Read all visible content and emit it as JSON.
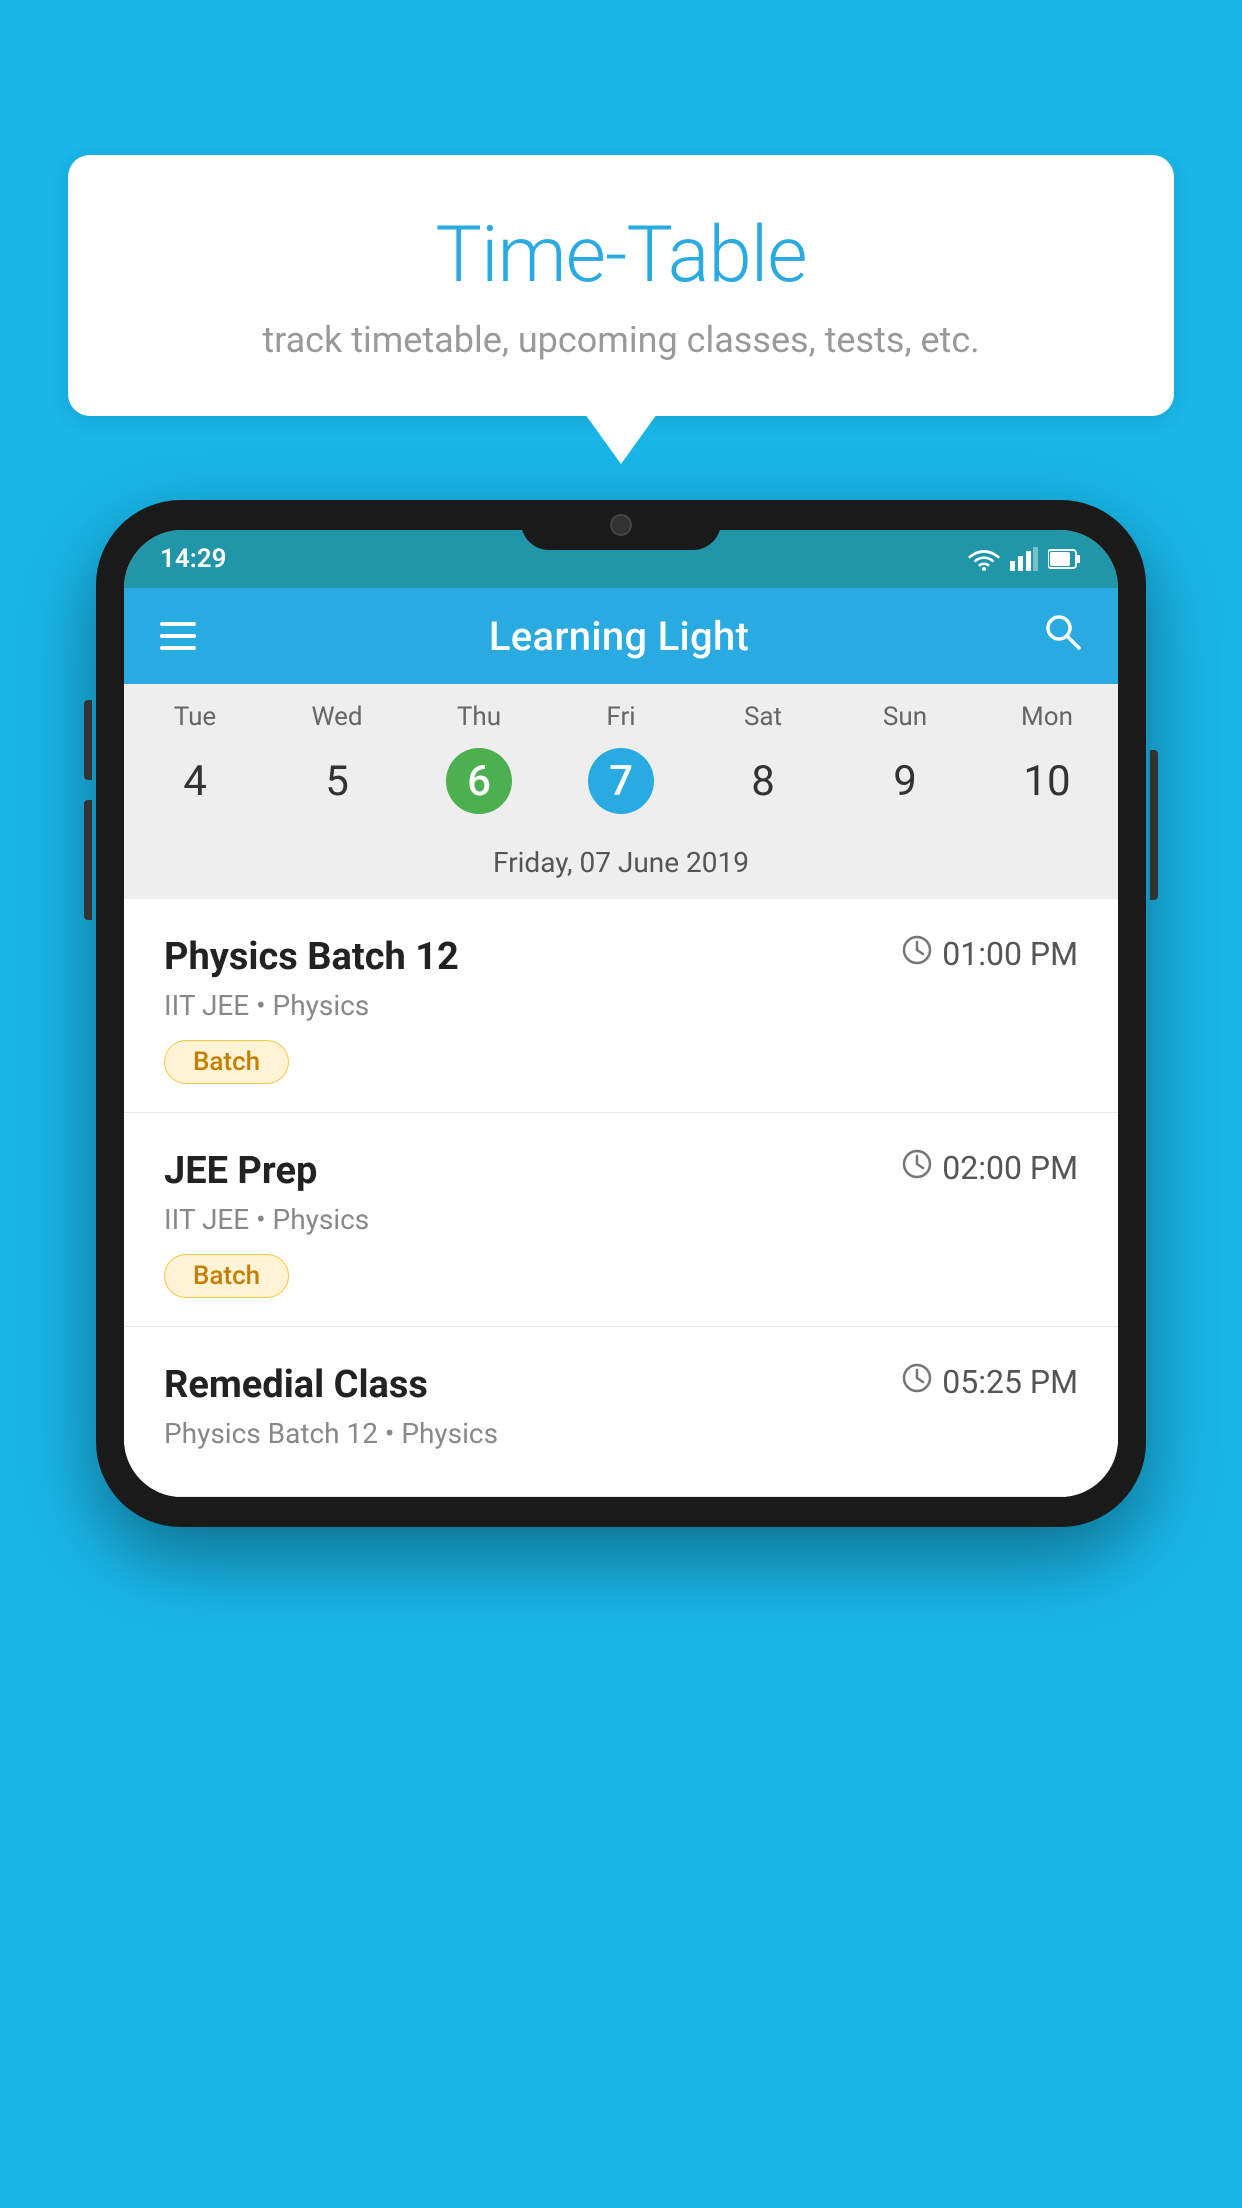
{
  "background_color": "#19b6e8",
  "speech_bubble": {
    "title": "Time-Table",
    "subtitle": "track timetable, upcoming classes, tests, etc."
  },
  "phone": {
    "status_bar": {
      "time": "14:29"
    },
    "app_bar": {
      "title": "Learning Light"
    },
    "calendar": {
      "days": [
        "Tue",
        "Wed",
        "Thu",
        "Fri",
        "Sat",
        "Sun",
        "Mon"
      ],
      "dates": [
        "4",
        "5",
        "6",
        "7",
        "8",
        "9",
        "10"
      ],
      "today_index": 2,
      "selected_index": 3,
      "selected_date_label": "Friday, 07 June 2019"
    },
    "classes": [
      {
        "name": "Physics Batch 12",
        "time": "01:00 PM",
        "meta": "IIT JEE • Physics",
        "badge": "Batch"
      },
      {
        "name": "JEE Prep",
        "time": "02:00 PM",
        "meta": "IIT JEE • Physics",
        "badge": "Batch"
      },
      {
        "name": "Remedial Class",
        "time": "05:25 PM",
        "meta": "Physics Batch 12 • Physics",
        "badge": null
      }
    ]
  }
}
